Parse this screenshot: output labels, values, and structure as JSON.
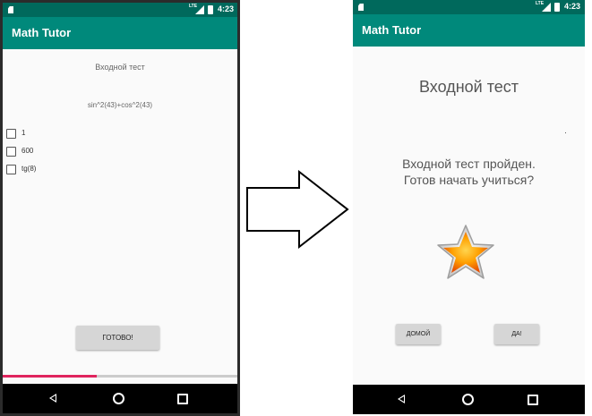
{
  "left_screen": {
    "status_time": "4:23",
    "status_lte": "LTE",
    "app_title": "Math Tutor",
    "heading": "Входной тест",
    "question": "sin^2(43)+cos^2(43)",
    "options": [
      {
        "label": "1",
        "checked": false
      },
      {
        "label": "600",
        "checked": false
      },
      {
        "label": "tg(8)",
        "checked": false
      }
    ],
    "done_button": "ГОТОВО!",
    "progress": 0.4,
    "colors": {
      "status_bar": "#00695c",
      "app_bar": "#00897b",
      "progress": "#e0245e"
    }
  },
  "arrow": {
    "icon": "right-arrow-icon"
  },
  "right_screen": {
    "status_time": "4:23",
    "status_lte": "LTE",
    "app_title": "Math Tutor",
    "heading": "Входной тест",
    "message_line1": "Входной тест пройден.",
    "message_line2": "Готов начать учиться?",
    "icon": "star-icon",
    "home_button": "ДОМОЙ",
    "yes_button": "ДА!"
  }
}
